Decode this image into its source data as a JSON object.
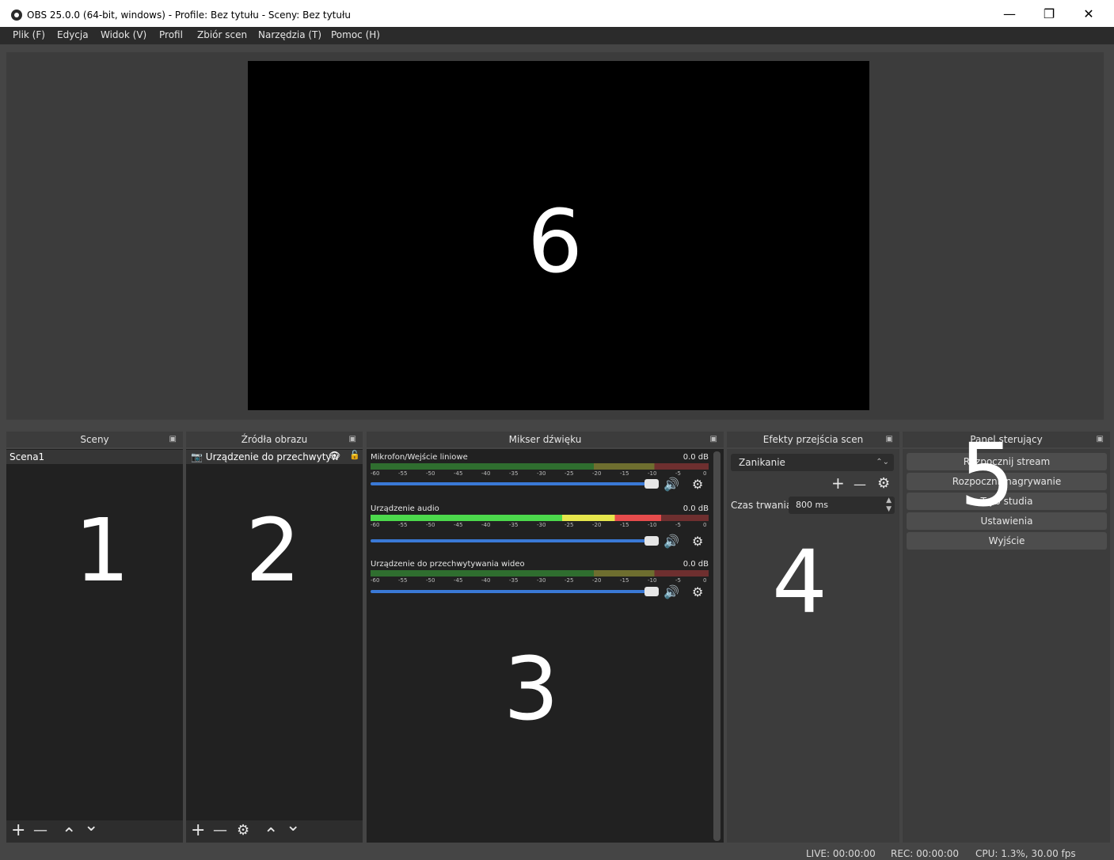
{
  "window": {
    "title": "OBS 25.0.0 (64-bit, windows) - Profile: Bez tytułu - Sceny: Bez tytułu",
    "minimize": "—",
    "restore": "❐",
    "close": "✕"
  },
  "menu": [
    "Plik (F)",
    "Edycja",
    "Widok (V)",
    "Profil",
    "Zbiór scen",
    "Narzędzia (T)",
    "Pomoc (H)"
  ],
  "overlay_numbers": {
    "scenes": "1",
    "sources": "2",
    "mixer": "3",
    "transitions": "4",
    "controls": "5",
    "preview": "6"
  },
  "scenes": {
    "header": "Sceny",
    "items": [
      "Scena1"
    ],
    "toolbar": {
      "add": "+",
      "remove": "—",
      "up": "⌃",
      "down": "⌄"
    }
  },
  "sources": {
    "header": "Źródła obrazu",
    "items": [
      {
        "label": "Urządzenie do przechwytyw",
        "icon": "camera-icon"
      }
    ],
    "toolbar": {
      "add": "+",
      "remove": "—",
      "settings": "⚙",
      "up": "⌃",
      "down": "⌄"
    }
  },
  "mixer": {
    "header": "Mikser dźwięku",
    "scale": [
      "-60",
      "-55",
      "-50",
      "-45",
      "-40",
      "-35",
      "-30",
      "-25",
      "-20",
      "-15",
      "-10",
      "-5",
      "0"
    ],
    "channels": [
      {
        "name": "Mikrofon/Wejście liniowe",
        "db": "0.0 dB",
        "level": 0
      },
      {
        "name": "Urządzenie audio",
        "db": "0.0 dB",
        "level": 0.86
      },
      {
        "name": "Urządzenie do przechwytywania wideo",
        "db": "0.0 dB",
        "level": 0
      }
    ]
  },
  "transitions": {
    "header": "Efekty przejścia scen",
    "selected": "Zanikanie",
    "duration_label": "Czas trwania",
    "duration_value": "800 ms"
  },
  "controls": {
    "header": "Panel sterujący",
    "buttons": [
      "Rozpocznij stream",
      "Rozpocznij nagrywanie",
      "Tryb studia",
      "Ustawienia",
      "Wyjście"
    ]
  },
  "status": {
    "live": "LIVE: 00:00:00",
    "rec": "REC: 00:00:00",
    "cpu": "CPU: 1.3%, 30.00 fps"
  },
  "colors": {
    "background": "#454545",
    "dock_body": "#212121",
    "slider": "#3a79d6"
  }
}
